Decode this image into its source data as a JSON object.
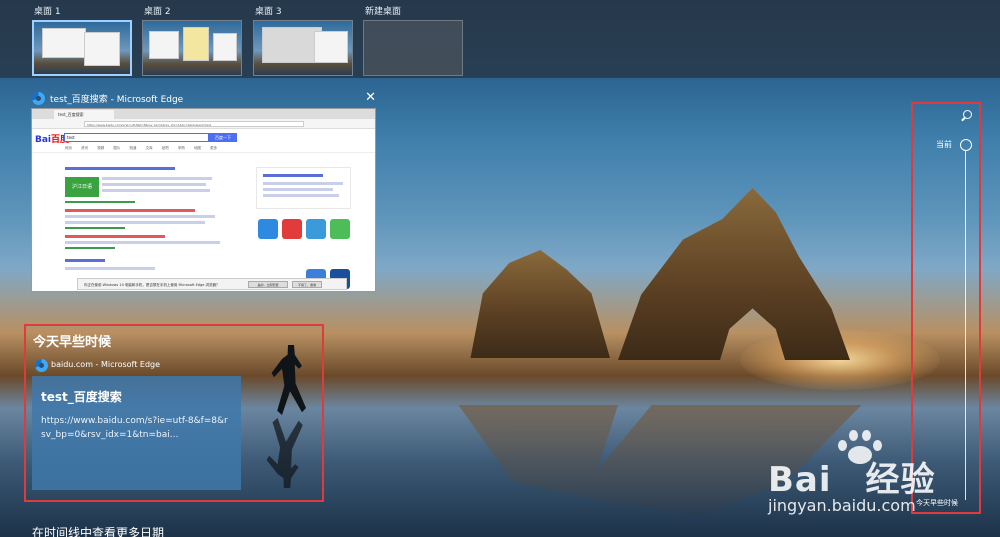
{
  "desktops": [
    {
      "label": "桌面 1",
      "active": true
    },
    {
      "label": "桌面 2",
      "active": false
    },
    {
      "label": "桌面 3",
      "active": false
    }
  ],
  "new_desktop_label": "新建桌面",
  "window_preview": {
    "title": "test_百度搜索 - Microsoft Edge",
    "browser": {
      "tab_label": "test_百度搜索",
      "url": "https://www.baidu.com/s?ie=utf-8&f=8&rsv_bp=0&rsv_idx=1&tn=baidu&wd=test",
      "logo": "百度",
      "search_value": "test",
      "search_button": "百度一下",
      "nav_tabs": [
        "网页",
        "资讯",
        "视频",
        "图片",
        "知道",
        "文库",
        "贴吧",
        "采购",
        "地图",
        "更多"
      ],
      "result_logo": "沪江日语",
      "dialog_text": "你正在使用 Windows 10 电脑和手机，是否想在手机上使用 Microsoft Edge 浏览器？",
      "dialog_buttons": [
        "是的，立即安装",
        "不用了，谢谢"
      ]
    }
  },
  "earlier_today": {
    "heading": "今天早些时候",
    "source": "baidu.com - Microsoft Edge",
    "card_title": "test_百度搜索",
    "card_url": "https://www.baidu.com/s?ie=utf-8&f=8&rsv_bp=0&rsv_idx=1&tn=bai..."
  },
  "more_dates_link": "在时间线中查看更多日期",
  "timeline": {
    "current_label": "当前",
    "end_label": "今天早些时候"
  },
  "watermark": {
    "brand": "Bai",
    "brand_suffix": "经验",
    "url": "jingyan.baidu.com"
  },
  "colors": {
    "annotation": "#e03a3a",
    "card": "#3e78aa"
  }
}
